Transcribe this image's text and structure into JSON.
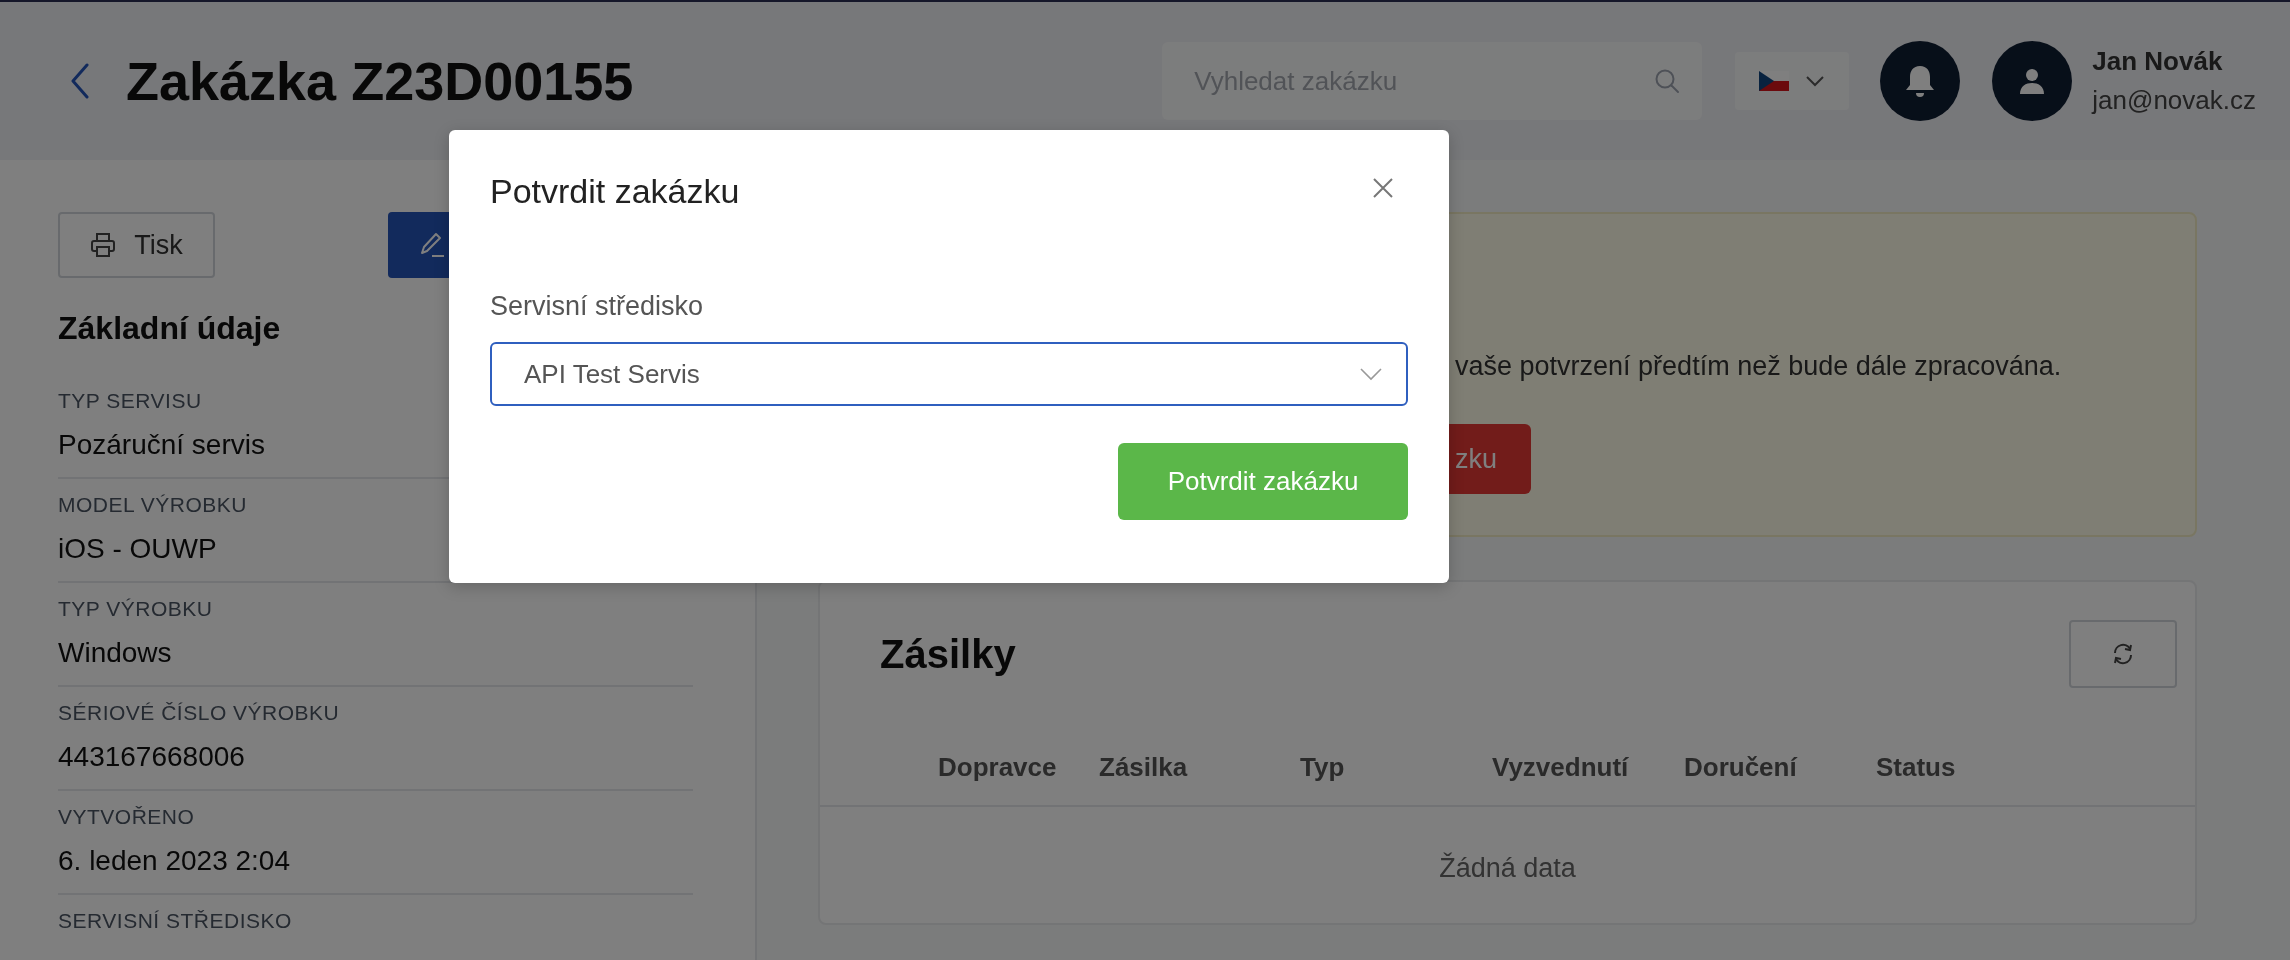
{
  "header": {
    "title": "Zakázka Z23D00155",
    "search": {
      "placeholder": "Vyhledat zakázku"
    },
    "user": {
      "name": "Jan Novák",
      "email": "jan@novak.cz"
    }
  },
  "sidebar": {
    "buttons": [
      {
        "kind": "print",
        "label": "Tisk"
      },
      {
        "kind": "edit"
      }
    ],
    "heading": "Základní údaje",
    "fields": [
      {
        "label": "TYP SERVISU",
        "value": "Pozáruční servis"
      },
      {
        "label": "MODEL VÝROBKU",
        "value": "iOS - OUWP"
      },
      {
        "label": "TYP VÝROBKU",
        "value": "Windows"
      },
      {
        "label": "SÉRIOVÉ ČÍSLO VÝROBKU",
        "value": "443167668006"
      },
      {
        "label": "VYTVOŘENO",
        "value": "6. leden 2023 2:04"
      },
      {
        "label": "SERVISNÍ STŘEDISKO"
      }
    ]
  },
  "alert": {
    "text": "vaše potvrzení předtím než bude dále zpracována.",
    "button": "zku"
  },
  "shipments": {
    "title": "Zásilky",
    "columns": [
      "Dopravce",
      "Zásilka",
      "Typ",
      "Vyzvednutí",
      "Doručení",
      "Status"
    ],
    "empty": "Žádná data"
  },
  "modal": {
    "title": "Potvrdit zakázku",
    "field": {
      "label": "Servisní středisko",
      "value": "API Test Servis"
    },
    "button": "Potvrdit zakázku"
  }
}
